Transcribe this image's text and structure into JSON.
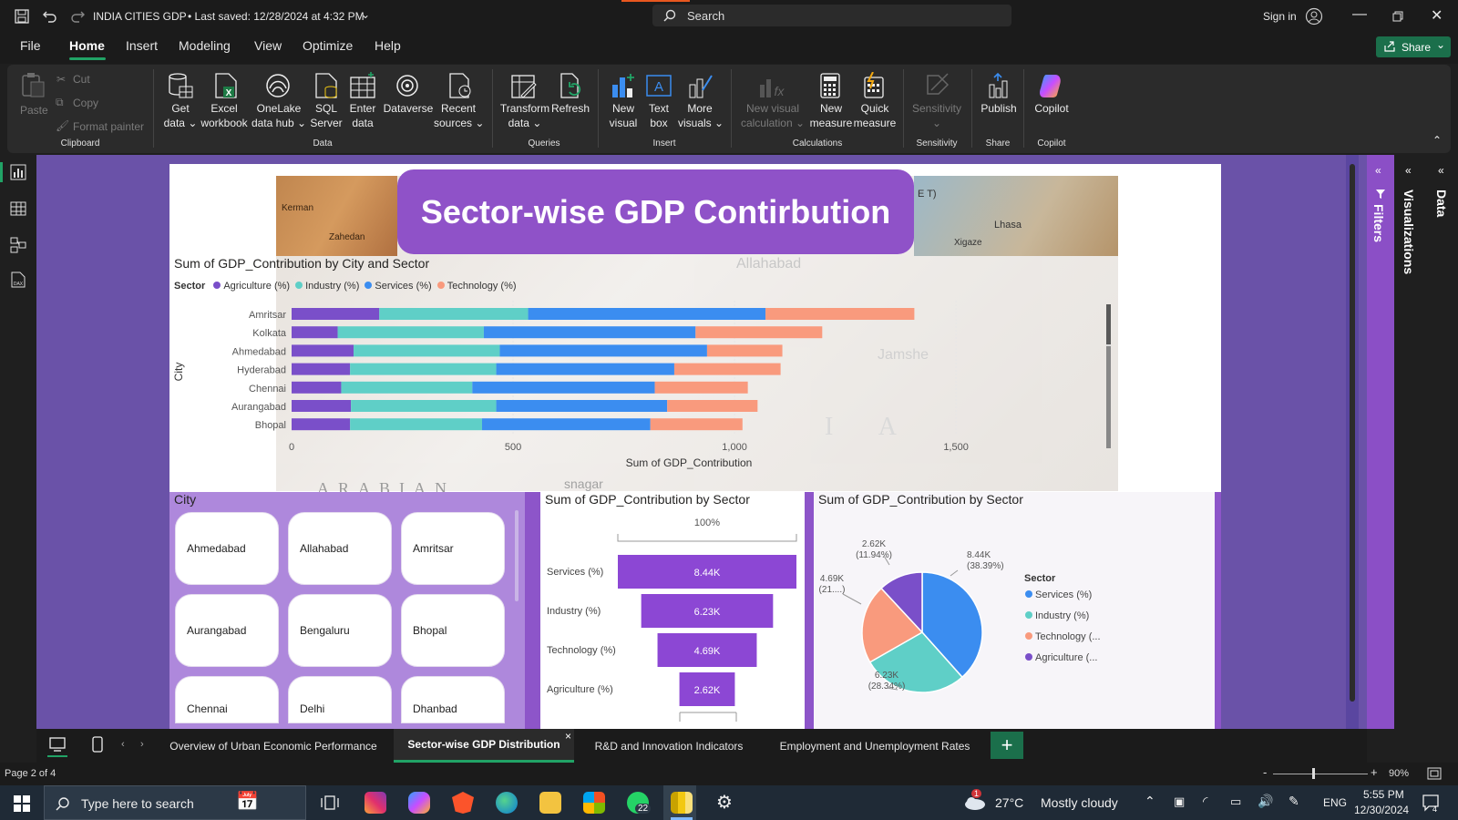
{
  "titlebar": {
    "file_title": "INDIA CITIES GDP",
    "saved": "• Last saved: 12/28/2024 at 4:32 PM",
    "search_label": "Search",
    "sign_in": "Sign in"
  },
  "menu": {
    "items": [
      "File",
      "Home",
      "Insert",
      "Modeling",
      "View",
      "Optimize",
      "Help"
    ],
    "active": "Home",
    "share": "Share"
  },
  "ribbon": {
    "clipboard": {
      "paste": "Paste",
      "cut": "Cut",
      "copy": "Copy",
      "format_painter": "Format painter",
      "group": "Clipboard"
    },
    "data": {
      "get_data": [
        "Get",
        "data"
      ],
      "excel": [
        "Excel",
        "workbook"
      ],
      "onelake": [
        "OneLake",
        "data hub"
      ],
      "sql": [
        "SQL",
        "Server"
      ],
      "enter": [
        "Enter",
        "data"
      ],
      "dataverse": "Dataverse",
      "recent": [
        "Recent",
        "sources"
      ],
      "group": "Data"
    },
    "queries": {
      "transform": [
        "Transform",
        "data"
      ],
      "refresh": "Refresh",
      "group": "Queries"
    },
    "insert": {
      "new_visual": [
        "New",
        "visual"
      ],
      "text_box": [
        "Text",
        "box"
      ],
      "more_visuals": [
        "More",
        "visuals"
      ],
      "group": "Insert"
    },
    "calculations": {
      "new_visual_calc": [
        "New visual",
        "calculation"
      ],
      "new_measure": [
        "New",
        "measure"
      ],
      "quick_measure": [
        "Quick",
        "measure"
      ],
      "group": "Calculations"
    },
    "sensitivity": {
      "label": "Sensitivity",
      "group": "Sensitivity"
    },
    "share": {
      "publish": "Publish",
      "group": "Share"
    },
    "copilot": {
      "label": "Copilot",
      "group": "Copilot"
    }
  },
  "report": {
    "banner_title": "Sector-wise GDP Contirbution",
    "map_labels": [
      "Kerman",
      "Zahedan",
      "E T)",
      "Lhasa",
      "Xigaze"
    ],
    "map_band_labels": [
      "ARABIAN",
      "Allahabad",
      "Jamshe",
      "I A",
      "snagar",
      "Hyderabad"
    ]
  },
  "bar_chart": {
    "title": "Sum of GDP_Contribution by City and Sector",
    "legend_title": "Sector",
    "ylabel": "City",
    "xlabel": "Sum of GDP_Contribution"
  },
  "slicer": {
    "title": "City",
    "items": [
      "Ahmedabad",
      "Allahabad",
      "Amritsar",
      "Aurangabad",
      "Bengaluru",
      "Bhopal",
      "Chennai",
      "Delhi",
      "Dhanbad"
    ]
  },
  "funnel_chart": {
    "title": "Sum of GDP_Contribution by Sector",
    "top_label": "100%"
  },
  "pie_chart": {
    "title": "Sum of GDP_Contribution by Sector",
    "legend_title": "Sector",
    "legend_items": [
      "Services (%)",
      "Industry (%)",
      "Technology (...",
      "Agriculture (..."
    ],
    "slice_labels": [
      {
        "value": "8.44K",
        "pct": "(38.39%)"
      },
      {
        "value": "6.23K",
        "pct": "(28.34%)"
      },
      {
        "value": "4.69K",
        "pct": "(21....)"
      },
      {
        "value": "2.62K",
        "pct": "(11.94%)"
      }
    ]
  },
  "chart_data": [
    {
      "type": "bar",
      "orientation": "horizontal-stacked",
      "title": "Sum of GDP_Contribution by City and Sector",
      "xlabel": "Sum of GDP_Contribution",
      "ylabel": "City",
      "categories": [
        "Amritsar",
        "Kolkata",
        "Ahmedabad",
        "Hyderabad",
        "Chennai",
        "Aurangabad",
        "Bhopal"
      ],
      "series": [
        {
          "name": "Agriculture (%)",
          "color": "#7a4fc9",
          "values": [
            198,
            104,
            140,
            132,
            112,
            134,
            132
          ]
        },
        {
          "name": "Industry (%)",
          "color": "#5fcfc7",
          "values": [
            336,
            330,
            330,
            330,
            296,
            328,
            298
          ]
        },
        {
          "name": "Services (%)",
          "color": "#3b8df0",
          "values": [
            536,
            478,
            468,
            402,
            412,
            386,
            380
          ]
        },
        {
          "name": "Technology (%)",
          "color": "#f99a7d",
          "values": [
            336,
            286,
            170,
            240,
            210,
            204,
            208
          ]
        }
      ],
      "xticks": [
        0,
        500,
        1000,
        1500
      ],
      "xtick_labels": [
        "0",
        "500",
        "1,000",
        "1,500"
      ],
      "xlim": [
        0,
        1650
      ],
      "legend": "top-left"
    },
    {
      "type": "funnel",
      "title": "Sum of GDP_Contribution by Sector",
      "categories": [
        "Services (%)",
        "Industry (%)",
        "Technology (%)",
        "Agriculture (%)"
      ],
      "values": [
        8440,
        6230,
        4690,
        2620
      ],
      "value_labels": [
        "8.44K",
        "6.23K",
        "4.69K",
        "2.62K"
      ],
      "color": "#8c47d4"
    },
    {
      "type": "pie",
      "title": "Sum of GDP_Contribution by Sector",
      "categories": [
        "Services (%)",
        "Industry (%)",
        "Technology (%)",
        "Agriculture (%)"
      ],
      "values": [
        8440,
        6230,
        4690,
        2620
      ],
      "percentages": [
        38.39,
        28.34,
        21.33,
        11.94
      ],
      "colors": [
        "#3b8df0",
        "#5fcfc7",
        "#f99a7d",
        "#7a4fc9"
      ],
      "legend": "right"
    }
  ],
  "side_panels": {
    "filters": "Filters",
    "visualizations": "Visualizations",
    "data": "Data"
  },
  "tabs": {
    "items": [
      "Overview of Urban Economic Performance",
      "Sector-wise GDP Distribution",
      "R&D and Innovation Indicators",
      "Employment and Unemployment Rates"
    ],
    "active": "Sector-wise GDP Distribution",
    "close": "×",
    "add": "+"
  },
  "status": {
    "page": "Page 2 of 4",
    "zoom": "90%",
    "zoom_minus": "-",
    "zoom_plus": "+"
  },
  "taskbar": {
    "search_placeholder": "Type here to search",
    "whatsapp_badge": "22",
    "weather_temp": "27°C",
    "weather_text": "Mostly cloudy",
    "weather_badge": "1",
    "language": "ENG",
    "time": "5:55 PM",
    "date": "12/30/2024",
    "notif_count": "4"
  },
  "colors": {
    "accent": "#21a366",
    "banner": "#8f52c8",
    "report_bg": "#8d55c9"
  }
}
